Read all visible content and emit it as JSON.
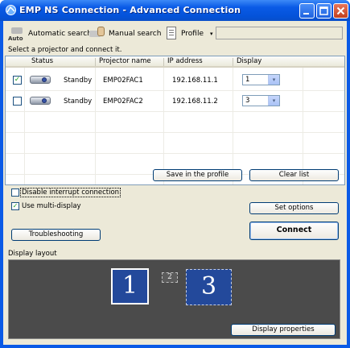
{
  "window": {
    "title": "EMP NS Connection  -  Advanced Connection"
  },
  "toolbar": {
    "auto_icon_text": "Auto",
    "automatic_search": "Automatic search",
    "manual_search": "Manual search",
    "profile": "Profile",
    "profile_arrow": "▾",
    "profile_value": ""
  },
  "hint": "Select a projector and connect it.",
  "list": {
    "columns": [
      "Status",
      "Projector name",
      "IP address",
      "Display"
    ],
    "rows": [
      {
        "checked": true,
        "check_glyph": "✓",
        "status": "Standby",
        "name": "EMP02FAC1",
        "ip": "192.168.11.1",
        "display": "1"
      },
      {
        "checked": false,
        "check_glyph": "",
        "status": "Standby",
        "name": "EMP02FAC2",
        "ip": "192.168.11.2",
        "display": "3"
      }
    ],
    "dropdown_glyph": "▾"
  },
  "buttons": {
    "save_profile": "Save in the profile",
    "clear_list": "Clear list",
    "set_options": "Set options",
    "troubleshooting": "Troubleshooting",
    "connect": "Connect",
    "display_properties": "Display properties"
  },
  "options": {
    "disable_interrupt": {
      "label": "Disable interrupt connection",
      "checked": false,
      "glyph": ""
    },
    "use_multi_display": {
      "label": "Use multi-display",
      "checked": true,
      "glyph": "✓"
    }
  },
  "layout": {
    "label": "Display layout",
    "displays": [
      "1",
      "2",
      "3"
    ]
  },
  "colors": {
    "titlebar": "#0a5ae6",
    "dialog_bg": "#ece9d8",
    "display_active": "#23499b",
    "layout_bg": "#4b4b4b"
  }
}
